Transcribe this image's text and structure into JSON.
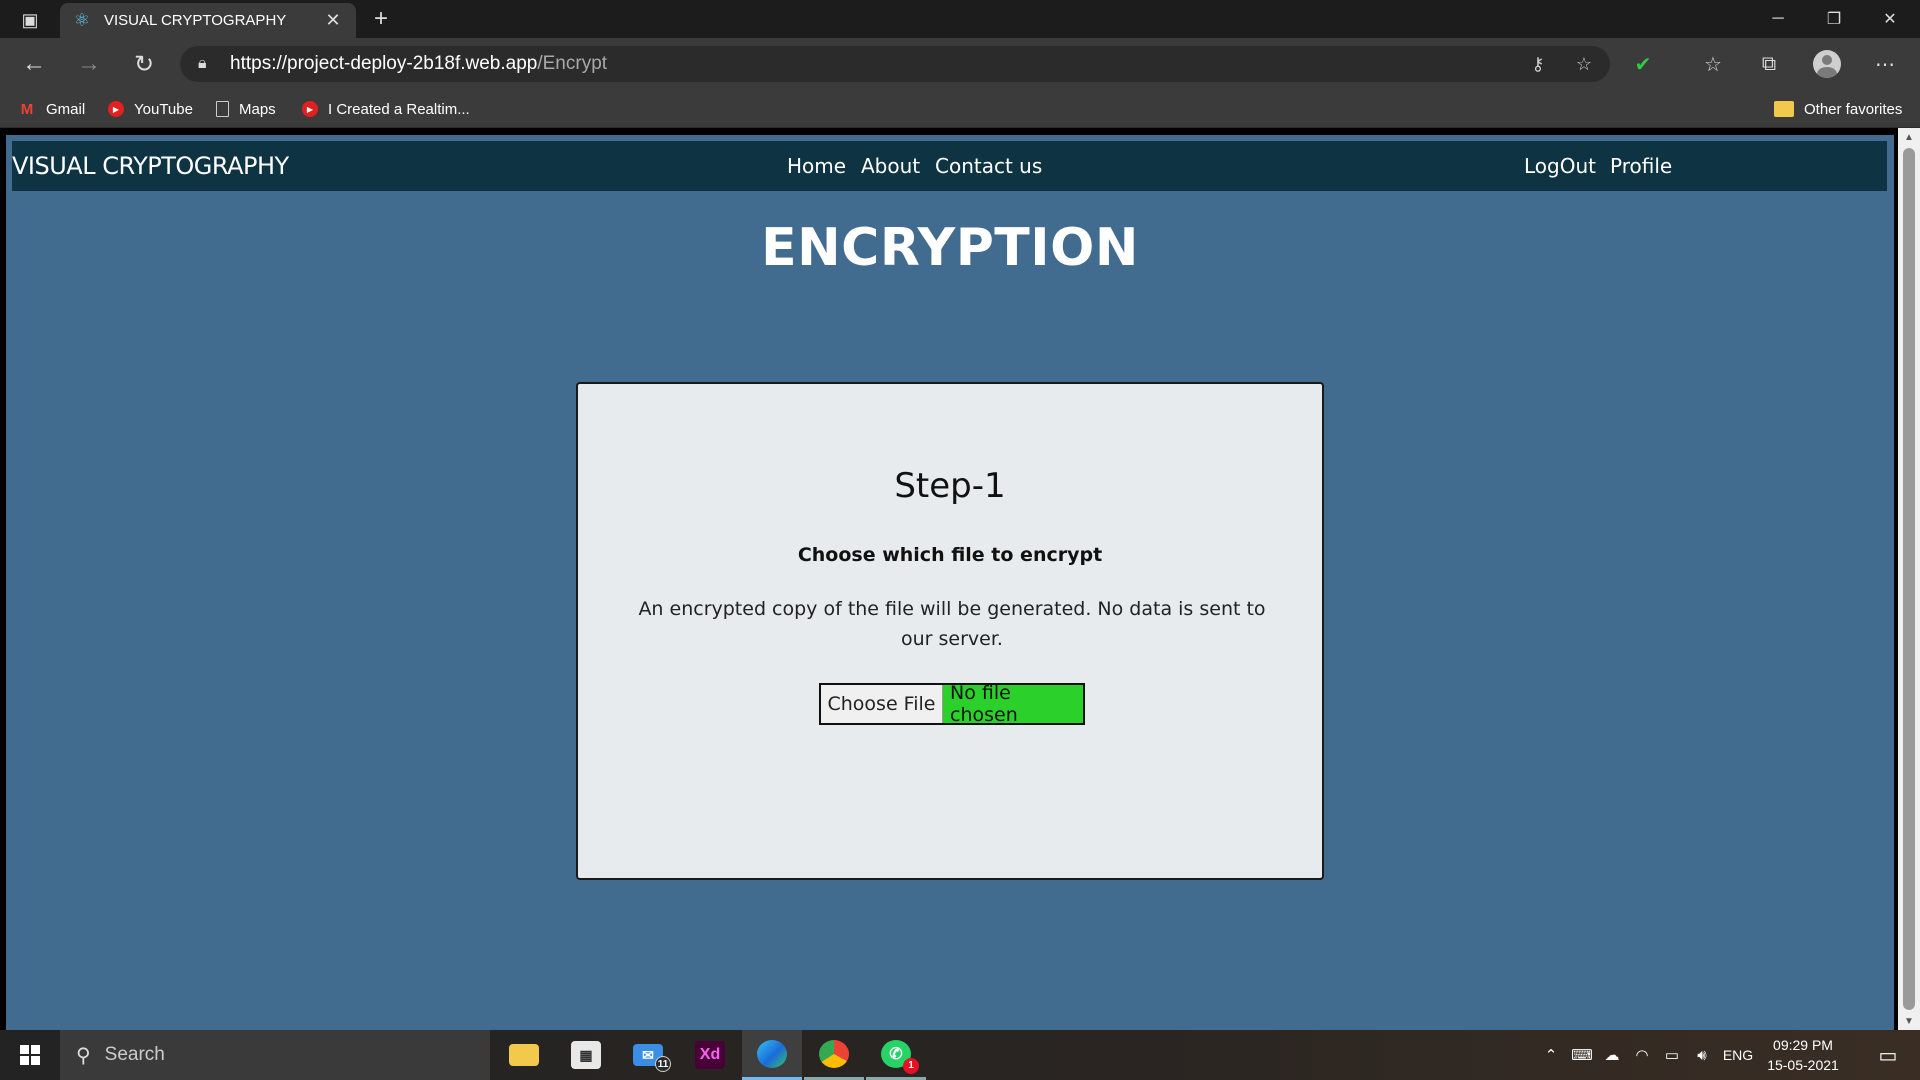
{
  "browser": {
    "tab_title": "VISUAL CRYPTOGRAPHY",
    "url_host": "https://project-deploy-2b18f.web.app",
    "url_path": "/Encrypt",
    "favorites": [
      "Gmail",
      "YouTube",
      "Maps",
      "I Created a Realtim..."
    ],
    "other_favorites": "Other favorites"
  },
  "site": {
    "brand": "VISUAL CRYPTOGRAPHY",
    "nav": {
      "home": "Home",
      "about": "About",
      "contact": "Contact us",
      "logout": "LogOut",
      "profile": "Profile"
    },
    "page_title": "ENCRYPTION",
    "card": {
      "step": "Step-1",
      "heading": "Choose which file to encrypt",
      "description": "An encrypted copy of the file will be generated. No data is sent to our server.",
      "file_button": "Choose File",
      "file_status": "No file chosen"
    }
  },
  "taskbar": {
    "search_placeholder": "Search",
    "mail_badge": "11",
    "whatsapp_badge": "1",
    "language": "ENG",
    "time": "09:29 PM",
    "date": "15-05-2021"
  },
  "colors": {
    "page_bg": "#426c8f",
    "navbar_bg": "#0e3443",
    "card_bg": "#e8ebee",
    "file_status_bg": "#2bd02b"
  },
  "icons": [
    "tab-actions-icon",
    "react-favicon-icon",
    "close-icon",
    "plus-icon",
    "back-icon",
    "forward-icon",
    "refresh-icon",
    "lock-icon",
    "key-icon",
    "add-favorite-icon",
    "shield-check-icon",
    "favorites-icon",
    "collections-icon",
    "profile-icon",
    "more-icon",
    "windows-icon",
    "search-icon"
  ]
}
